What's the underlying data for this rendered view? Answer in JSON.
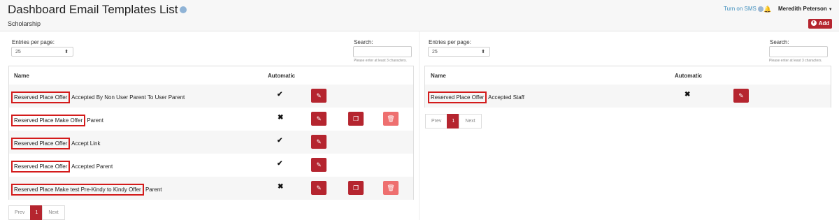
{
  "header": {
    "title": "Dashboard Email Templates List",
    "subtitle": "Scholarship",
    "sms_link": "Turn on SMS",
    "user_name": "Meredith Peterson",
    "add_label": "Add",
    "icons": {
      "help": "question-circle-icon",
      "bell": "bell-icon",
      "caret": "caret-down-icon",
      "add": "plus-circle-icon"
    }
  },
  "left": {
    "entries_label": "Entries per page:",
    "entries_value": "25",
    "search_label": "Search:",
    "search_value": "",
    "search_hint": "Please enter at least 3 characters.",
    "columns": [
      "Name",
      "Automatic"
    ],
    "rows": [
      {
        "highlight": "Reserved Place Offer",
        "rest": " Accepted By Non User Parent To User Parent",
        "automatic": "✔",
        "actions": [
          "edit"
        ]
      },
      {
        "highlight": "Reserved Place Make Offer",
        "rest": " Parent",
        "automatic": "✖",
        "actions": [
          "edit",
          "copy",
          "delete"
        ]
      },
      {
        "highlight": "Reserved Place Offer",
        "rest": " Accept Link",
        "automatic": "✔",
        "actions": [
          "edit"
        ]
      },
      {
        "highlight": "Reserved Place Offer",
        "rest": " Accepted Parent",
        "automatic": "✔",
        "actions": [
          "edit"
        ]
      },
      {
        "highlight": "Reserved Place Make test Pre-Kindy to Kindy Offer",
        "rest": " Parent",
        "automatic": "✖",
        "actions": [
          "edit",
          "copy",
          "delete"
        ]
      }
    ],
    "pager": {
      "prev": "Prev",
      "page": "1",
      "next": "Next"
    }
  },
  "right": {
    "entries_label": "Entries per page:",
    "entries_value": "25",
    "search_label": "Search:",
    "search_value": "",
    "search_hint": "Please enter at least 3 characters.",
    "columns": [
      "Name",
      "Automatic"
    ],
    "rows": [
      {
        "highlight": "Reserved Place Offer",
        "rest": " Accepted Staff",
        "automatic": "✖",
        "actions": [
          "edit"
        ]
      }
    ],
    "pager": {
      "prev": "Prev",
      "page": "1",
      "next": "Next"
    }
  },
  "colors": {
    "primary": "#b5252f",
    "delete": "#ee6f6f",
    "highlight_border": "#d31b1b",
    "link": "#3c8dbc"
  }
}
